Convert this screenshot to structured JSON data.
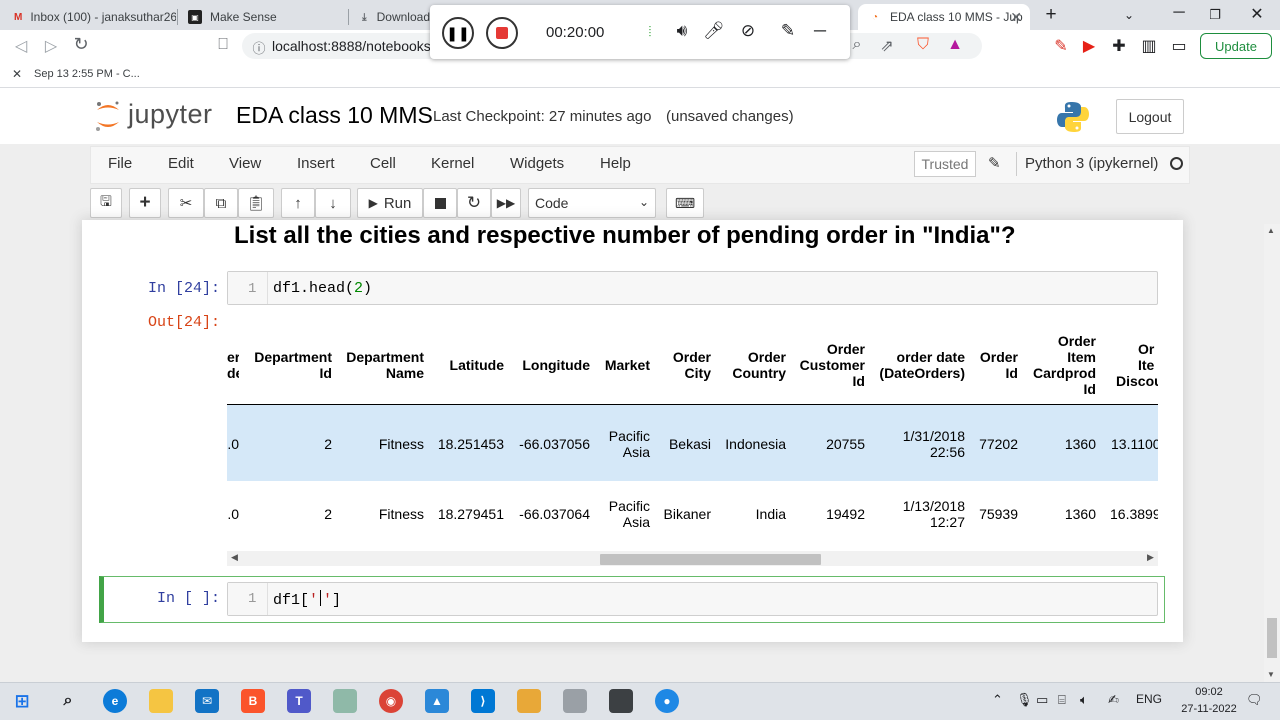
{
  "browser": {
    "tabs": [
      {
        "label": "Inbox (100) - janaksuthar26",
        "icon": "gmail-icon"
      },
      {
        "label": "Make Sense",
        "icon": "makesense-icon"
      },
      {
        "label": "Downloads",
        "icon": "download-icon"
      },
      {
        "label": "EDA class 10 MMS - Jup",
        "icon": "jupyter-icon",
        "active": true
      }
    ],
    "url": "localhost:8888/notebooks/l",
    "bookmark": "Sep 13 2:55 PM - C...",
    "update_label": "Update"
  },
  "recorder": {
    "time": "00:20:00"
  },
  "jupyter": {
    "logo_text": "jupyter",
    "notebook_name": "EDA class 10 MMS",
    "checkpoint": "Last Checkpoint: 27 minutes ago",
    "unsaved": "(unsaved changes)",
    "logout": "Logout",
    "menu": [
      "File",
      "Edit",
      "View",
      "Insert",
      "Cell",
      "Kernel",
      "Widgets",
      "Help"
    ],
    "trusted": "Trusted",
    "kernel": "Python 3 (ipykernel)",
    "run_label": "Run",
    "cell_type": "Code"
  },
  "notebook": {
    "heading": "List all the cities and respective number of pending order in \"India\"?",
    "cell1": {
      "prompt": "In [24]:",
      "line": "1",
      "code_prefix": "df1.head(",
      "code_num": "2",
      "code_suffix": ")"
    },
    "out_prompt": "Out[24]:",
    "cell2": {
      "prompt": "In [ ]:",
      "line": "1",
      "code_prefix": "df1[",
      "code_str": "'",
      "code_suffix": "]"
    }
  },
  "dataframe": {
    "columns": [
      [
        "er",
        "de"
      ],
      [
        "Department",
        "Id"
      ],
      [
        "Department",
        "Name"
      ],
      [
        "Latitude"
      ],
      [
        "Longitude"
      ],
      [
        "Market"
      ],
      [
        "Order",
        "City"
      ],
      [
        "Order",
        "Country"
      ],
      [
        "Order",
        "Customer",
        "Id"
      ],
      [
        "order date",
        "(DateOrders)"
      ],
      [
        "Order",
        "Id"
      ],
      [
        "Order",
        "Item",
        "Cardprod",
        "Id"
      ],
      [
        "Or",
        "Ite",
        "Discou"
      ]
    ],
    "rows": [
      [
        ".0",
        "2",
        "Fitness",
        "18.251453",
        "-66.037056",
        [
          "Pacific",
          "Asia"
        ],
        "Bekasi",
        "Indonesia",
        "20755",
        [
          "1/31/2018",
          "22:56"
        ],
        "77202",
        "1360",
        "13.1100"
      ],
      [
        ".0",
        "2",
        "Fitness",
        "18.279451",
        "-66.037064",
        [
          "Pacific",
          "Asia"
        ],
        "Bikaner",
        "India",
        "19492",
        [
          "1/13/2018",
          "12:27"
        ],
        "75939",
        "1360",
        "16.3899"
      ]
    ]
  },
  "taskbar": {
    "language": "ENG",
    "time": "09:02",
    "date": "27-11-2022"
  }
}
